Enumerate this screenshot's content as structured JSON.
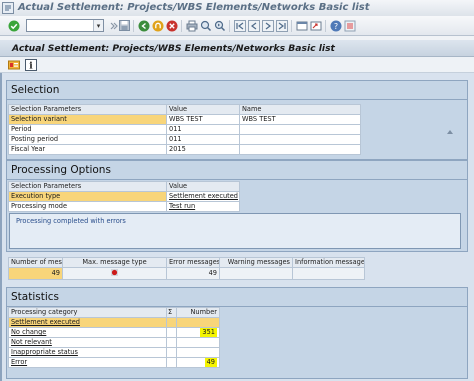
{
  "window": {
    "title": "Actual Settlement: Projects/WBS Elements/Networks Basic list"
  },
  "toolbar": {
    "command_field_value": "",
    "icons": [
      "enter-icon",
      "save-icon",
      "back-icon",
      "exit-icon",
      "cancel-icon",
      "print-icon",
      "find-icon"
    ]
  },
  "screen": {
    "title": "Actual Settlement: Projects/WBS Elements/Networks Basic list"
  },
  "app_toolbar": {
    "icons": [
      "settlement-detail-icon",
      "info-icon"
    ]
  },
  "selection": {
    "title": "Selection",
    "headers": [
      "Selection Parameters",
      "Value",
      "Name"
    ],
    "rows": [
      {
        "param": "Selection variant",
        "value": "WBS TEST",
        "name": "WBS TEST",
        "highlight": true
      },
      {
        "param": "Period",
        "value": "011",
        "name": ""
      },
      {
        "param": "Posting period",
        "value": "011",
        "name": ""
      },
      {
        "param": "Fiscal Year",
        "value": "2015",
        "name": ""
      }
    ]
  },
  "processing": {
    "title": "Processing Options",
    "headers": [
      "Selection Parameters",
      "Value"
    ],
    "rows": [
      {
        "param": "Execution type",
        "value": "Settlement executed",
        "highlight": true
      },
      {
        "param": "Processing mode",
        "value": "Test run"
      }
    ],
    "message": "Processing completed with errors"
  },
  "messages": {
    "headers": [
      "Number of mes",
      "Max. message type",
      "Error messages",
      "Warning messages",
      "Information messages"
    ],
    "values": {
      "number": "49",
      "error": "49",
      "warning": "",
      "information": ""
    },
    "status_color": "#cc1a1a"
  },
  "statistics": {
    "title": "Statistics",
    "headers": [
      "Processing category",
      "Σ",
      "Number"
    ],
    "rows": [
      {
        "category": "Settlement executed",
        "number": "",
        "highlight": true
      },
      {
        "category": "No change",
        "number": "351",
        "marked": true
      },
      {
        "category": "Not relevant",
        "number": ""
      },
      {
        "category": "Inappropriate status",
        "number": ""
      },
      {
        "category": "Error",
        "number": "49",
        "marked": true
      }
    ]
  }
}
